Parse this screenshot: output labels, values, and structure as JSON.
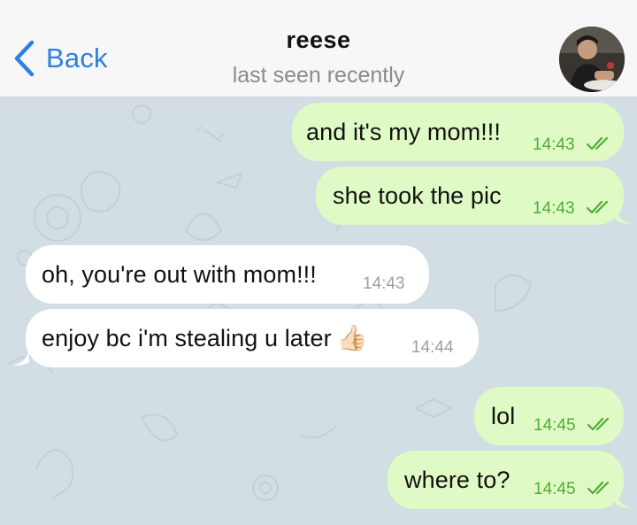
{
  "header": {
    "back_label": "Back",
    "contact_name": "reese",
    "status": "last seen recently"
  },
  "messages": [
    {
      "direction": "outgoing",
      "text": "and it's my mom!!!",
      "time": "14:43",
      "read": true
    },
    {
      "direction": "outgoing",
      "text": "she took the pic",
      "time": "14:43",
      "read": true
    },
    {
      "direction": "incoming",
      "text": "oh, you're out with mom!!!",
      "time": "14:43"
    },
    {
      "direction": "incoming",
      "text": "enjoy bc i'm stealing u later",
      "emoji": "👍🏻",
      "time": "14:44"
    },
    {
      "direction": "outgoing",
      "text": "lol",
      "time": "14:45",
      "read": true
    },
    {
      "direction": "outgoing",
      "text": "where to?",
      "time": "14:45",
      "read": true
    }
  ],
  "colors": {
    "accent": "#2f7fe0",
    "outgoing_bubble": "#e0fac6",
    "incoming_bubble": "#ffffff",
    "outgoing_time": "#4fae33",
    "chat_background": "#d3dde4"
  },
  "icons": {
    "back": "chevron-left-icon",
    "read_receipt": "double-check-icon",
    "avatar": "contact-photo"
  }
}
